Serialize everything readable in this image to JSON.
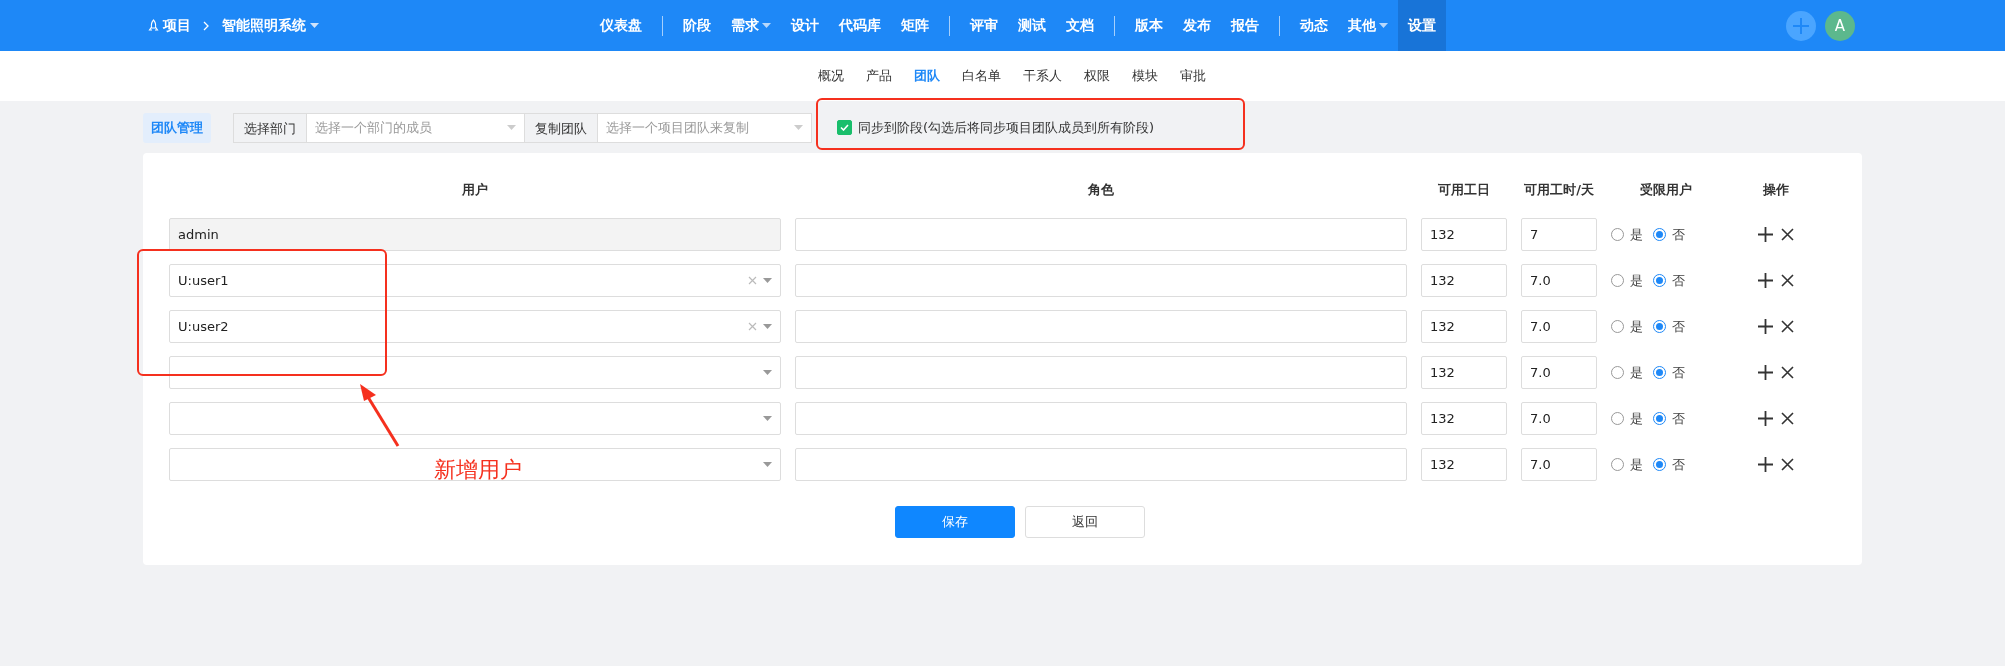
{
  "breadcrumb": {
    "root": "项目",
    "project": "智能照明系统"
  },
  "nav_groups": [
    [
      {
        "label": "仪表盘",
        "dropdown": false,
        "selected": false
      }
    ],
    [
      {
        "label": "阶段",
        "dropdown": false,
        "selected": false
      },
      {
        "label": "需求",
        "dropdown": true,
        "selected": false
      },
      {
        "label": "设计",
        "dropdown": false,
        "selected": false
      },
      {
        "label": "代码库",
        "dropdown": false,
        "selected": false
      },
      {
        "label": "矩阵",
        "dropdown": false,
        "selected": false
      }
    ],
    [
      {
        "label": "评审",
        "dropdown": false,
        "selected": false
      },
      {
        "label": "测试",
        "dropdown": false,
        "selected": false
      },
      {
        "label": "文档",
        "dropdown": false,
        "selected": false
      }
    ],
    [
      {
        "label": "版本",
        "dropdown": false,
        "selected": false
      },
      {
        "label": "发布",
        "dropdown": false,
        "selected": false
      },
      {
        "label": "报告",
        "dropdown": false,
        "selected": false
      }
    ],
    [
      {
        "label": "动态",
        "dropdown": false,
        "selected": false
      },
      {
        "label": "其他",
        "dropdown": true,
        "selected": false
      },
      {
        "label": "设置",
        "dropdown": false,
        "selected": true
      }
    ]
  ],
  "avatar": "A",
  "subnav": [
    {
      "label": "概况",
      "selected": false
    },
    {
      "label": "产品",
      "selected": false
    },
    {
      "label": "团队",
      "selected": true
    },
    {
      "label": "白名单",
      "selected": false
    },
    {
      "label": "干系人",
      "selected": false
    },
    {
      "label": "权限",
      "selected": false
    },
    {
      "label": "模块",
      "selected": false
    },
    {
      "label": "审批",
      "selected": false
    }
  ],
  "toolbar": {
    "title": "团队管理",
    "department": {
      "label": "选择部门",
      "placeholder": "选择一个部门的成员"
    },
    "copy_team": {
      "label": "复制团队",
      "placeholder": "选择一个项目团队来复制"
    },
    "sync": {
      "label": "同步到阶段(勾选后将同步项目团队成员到所有阶段)",
      "checked": true
    }
  },
  "table": {
    "columns": [
      "用户",
      "角色",
      "可用工日",
      "可用工时/天",
      "受限用户",
      "操作"
    ],
    "rows": [
      {
        "kind": "readonly",
        "user": "admin",
        "days": "132",
        "hours": "7",
        "restricted": [
          {
            "label": "是",
            "selected": false
          },
          {
            "label": "否",
            "selected": true
          }
        ]
      },
      {
        "kind": "select",
        "user": "U:user1",
        "days": "132",
        "hours": "7.0",
        "restricted": [
          {
            "label": "是",
            "selected": false
          },
          {
            "label": "否",
            "selected": true
          }
        ]
      },
      {
        "kind": "select",
        "user": "U:user2",
        "days": "132",
        "hours": "7.0",
        "restricted": [
          {
            "label": "是",
            "selected": false
          },
          {
            "label": "否",
            "selected": true
          }
        ]
      },
      {
        "kind": "select",
        "days": "132",
        "hours": "7.0",
        "restricted": [
          {
            "label": "是",
            "selected": false
          },
          {
            "label": "否",
            "selected": true
          }
        ]
      },
      {
        "kind": "select",
        "days": "132",
        "hours": "7.0",
        "restricted": [
          {
            "label": "是",
            "selected": false
          },
          {
            "label": "否",
            "selected": true
          }
        ]
      },
      {
        "kind": "select",
        "days": "132",
        "hours": "7.0",
        "restricted": [
          {
            "label": "是",
            "selected": false
          },
          {
            "label": "否",
            "selected": true
          }
        ]
      }
    ]
  },
  "buttons": [
    {
      "label": "保存",
      "kind": "primary"
    },
    {
      "label": "返回",
      "kind": "default"
    }
  ],
  "annotation": {
    "label": "新增用户"
  }
}
